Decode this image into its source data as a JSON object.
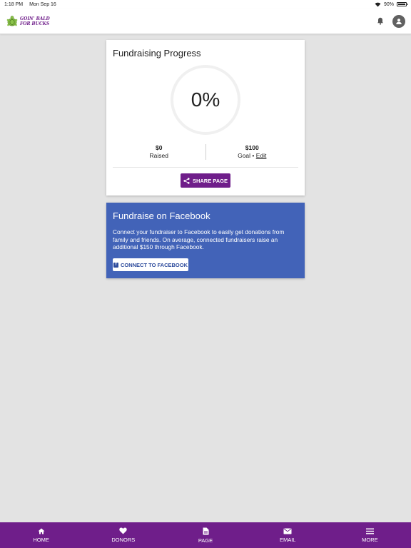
{
  "status_bar": {
    "time": "1:18 PM",
    "date": "Mon Sep 16",
    "battery": "90%"
  },
  "header": {
    "logo_line1": "GOIN' BALD",
    "logo_line2": "FOR BUCKS"
  },
  "progress": {
    "title": "Fundraising Progress",
    "percent_label": "0%",
    "percent_value": 0,
    "raised_value": "$0",
    "raised_label": "Raised",
    "goal_value": "$100",
    "goal_label": "Goal •",
    "edit_label": "Edit",
    "share_label": "SHARE PAGE"
  },
  "facebook": {
    "title": "Fundraise on Facebook",
    "description": "Connect your fundraiser to Facebook to easily get donations from family and friends. On average, connected fundraisers raise an additional $150 through Facebook.",
    "button_label": "CONNECT TO FACEBOOK"
  },
  "nav": {
    "items": [
      {
        "label": "HOME",
        "icon": "home-icon"
      },
      {
        "label": "DONORS",
        "icon": "heart-icon"
      },
      {
        "label": "PAGE",
        "icon": "page-icon"
      },
      {
        "label": "EMAIL",
        "icon": "email-icon"
      },
      {
        "label": "MORE",
        "icon": "menu-icon"
      }
    ]
  },
  "colors": {
    "brand": "#6f1e8a",
    "facebook": "#4263b8",
    "background": "#e3e3e3"
  }
}
